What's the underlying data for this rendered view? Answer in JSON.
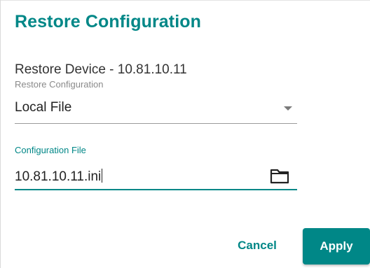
{
  "dialog": {
    "title": "Restore Configuration",
    "device_line": "Restore Device - 10.81.10.11",
    "colors": {
      "accent": "#008787",
      "text": "#333333",
      "label": "#8a8a8a"
    }
  },
  "restore_select": {
    "label": "Restore Configuration",
    "value": "Local File",
    "icon": "dropdown-arrow-icon"
  },
  "config_file": {
    "label": "Configuration File",
    "value": "10.81.10.11.ini",
    "icon": "folder-icon"
  },
  "actions": {
    "cancel_label": "Cancel",
    "apply_label": "Apply"
  }
}
